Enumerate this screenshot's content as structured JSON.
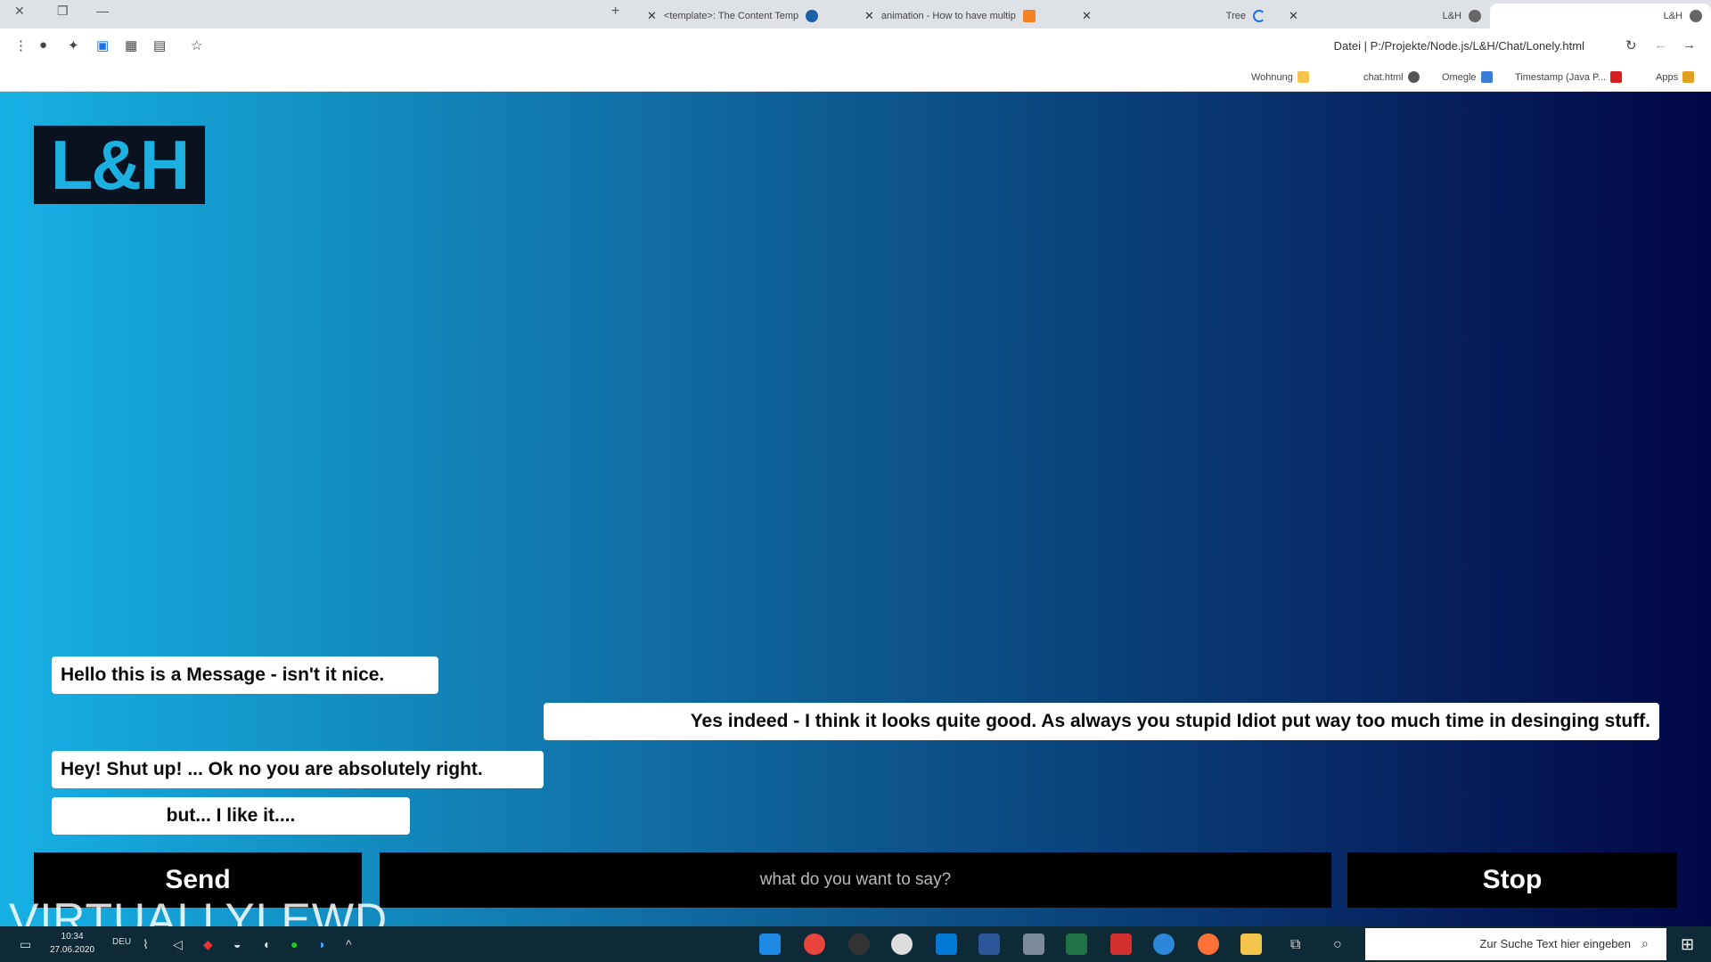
{
  "browser": {
    "tabs": [
      {
        "title": "<template>: The Content Temp"
      },
      {
        "title": "animation - How to have multip"
      },
      {
        "title": "Tree"
      },
      {
        "title": "L&H",
        "active": true
      },
      {
        "title": "L&H"
      }
    ],
    "address": "Datei  |  P:/Projekte/Node.js/L&H/Chat/Lonely.html",
    "bookmarks": [
      "Apps",
      "Timestamp (Java P...",
      "Omegle",
      "chat.html",
      "Wohnung"
    ]
  },
  "page": {
    "logo_text": "L&H",
    "messages": [
      {
        "text": "Hello this is a Message - isn't it nice.",
        "side": "left"
      },
      {
        "text": "Yes indeed - I think it looks quite good. As always you stupid Idiot put way too much time in desinging stuff.",
        "side": "right"
      },
      {
        "text": "Hey! Shut up! ... Ok no you are absolutely right.",
        "side": "left"
      },
      {
        "text": "but... I like it....",
        "side": "left"
      }
    ],
    "send_label": "Send",
    "input_placeholder": "what do you want to say?",
    "stop_label": "Stop",
    "watermark": "VIRTUALLYLEWD",
    "colors": {
      "gradient_start": "#16b1e4",
      "gradient_end": "#020646"
    }
  },
  "taskbar": {
    "search_placeholder": "Zur Suche Text hier eingeben",
    "time": "10:34",
    "date": "27.06.2020",
    "lang": "DEU"
  }
}
